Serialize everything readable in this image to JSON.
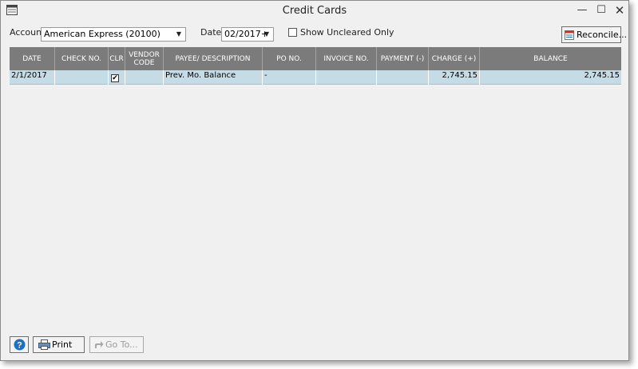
{
  "window": {
    "title": "Credit Cards",
    "controls": {
      "minimize": "—",
      "maximize": "☐",
      "close": "✕"
    }
  },
  "filters": {
    "account_label": "Account",
    "account_value": "American Express (20100)",
    "date_label": "Date",
    "date_value": "02/2017+",
    "uncleared_label": "Show Uncleared Only",
    "uncleared_checked": false
  },
  "toolbar": {
    "reconcile_label": "Reconcile..."
  },
  "grid": {
    "columns": [
      "DATE",
      "CHECK NO.",
      "CLR",
      "VENDOR CODE",
      "PAYEE/ DESCRIPTION",
      "PO NO.",
      "INVOICE NO.",
      "PAYMENT (-)",
      "CHARGE (+)",
      "BALANCE"
    ],
    "rows": [
      {
        "date": "2/1/2017",
        "check_no": "",
        "clr": true,
        "vendor_code": "",
        "payee": "Prev. Mo. Balance",
        "po_no": "-",
        "invoice_no": "",
        "payment": "",
        "charge": "2,745.15",
        "balance": "2,745.15"
      }
    ]
  },
  "footer": {
    "help_label": "?",
    "print_label": "Print",
    "goto_label": "Go To..."
  },
  "colors": {
    "header_bg": "#7b7b7b",
    "row_selected_bg": "#c5dce6",
    "help_blue": "#1e6fc0"
  },
  "icons": {
    "app": "window-icon",
    "reconcile": "reconcile-icon",
    "print": "printer-icon",
    "goto": "arrow-forward-icon",
    "help": "help-icon"
  }
}
